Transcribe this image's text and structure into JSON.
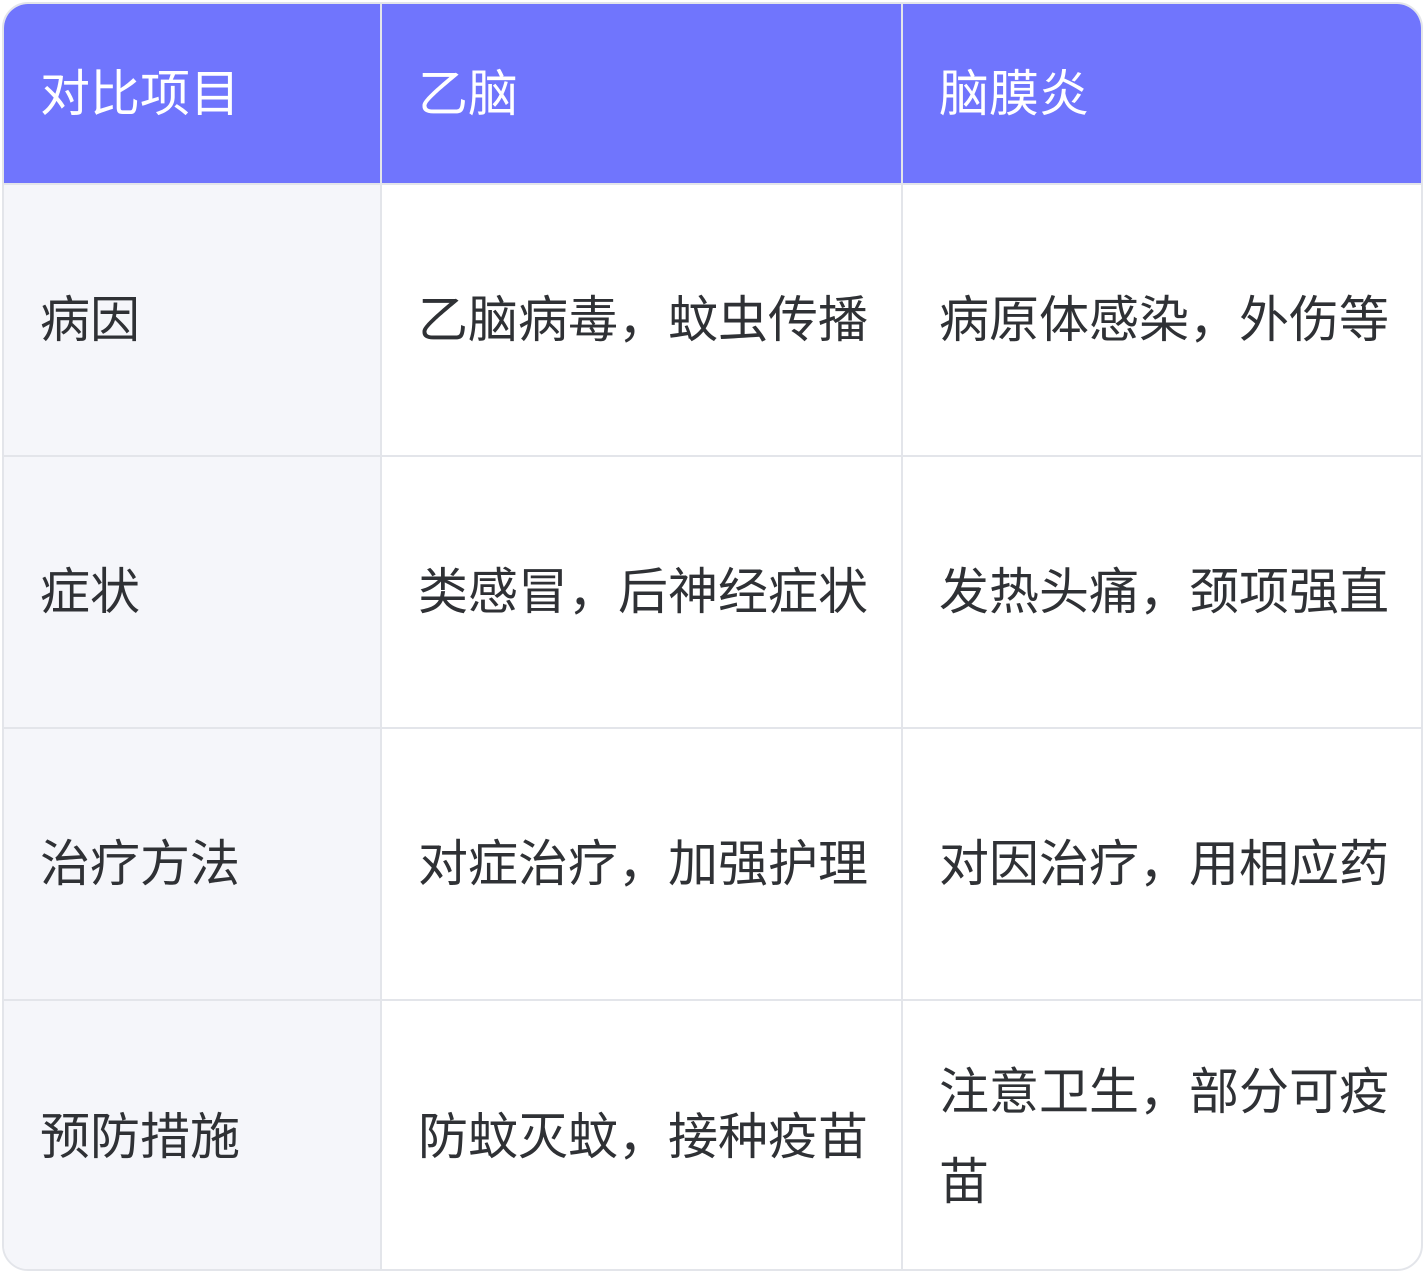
{
  "table": {
    "headers": [
      "对比项目",
      "乙脑",
      "脑膜炎"
    ],
    "rows": [
      {
        "label": "病因",
        "col1": "乙脑病毒，蚊虫传播",
        "col2": "病原体感染，外伤等"
      },
      {
        "label": "症状",
        "col1": "类感冒，后神经症状",
        "col2": "发热头痛，颈项强直"
      },
      {
        "label": "治疗方法",
        "col1": "对症治疗，加强护理",
        "col2": "对因治疗，用相应药"
      },
      {
        "label": "预防措施",
        "col1": "防蚊灭蚊，接种疫苗",
        "col2": "注意卫生，部分可疫苗"
      }
    ]
  },
  "colors": {
    "header_bg": "#7075fd",
    "header_text": "#ffffff",
    "label_bg": "#f5f6fa",
    "border": "#e3e5ea",
    "body_text": "#2f3135"
  }
}
